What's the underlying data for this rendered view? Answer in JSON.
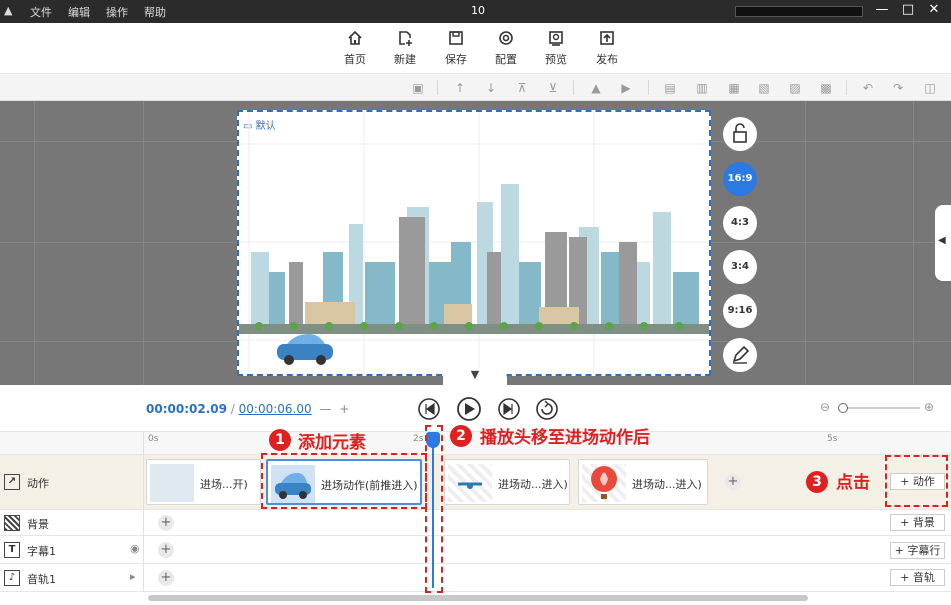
{
  "titlebar": {
    "menus": [
      "文件",
      "编辑",
      "操作",
      "帮助"
    ],
    "title": "10",
    "min": "—",
    "max": "□",
    "close": "✕"
  },
  "toolbar": {
    "items": [
      {
        "label": "首页",
        "icon": "home-icon"
      },
      {
        "label": "新建",
        "icon": "new-file-icon"
      },
      {
        "label": "保存",
        "icon": "save-icon"
      },
      {
        "label": "配置",
        "icon": "settings-icon"
      },
      {
        "label": "预览",
        "icon": "preview-icon"
      },
      {
        "label": "发布",
        "icon": "publish-icon"
      }
    ]
  },
  "canvas": {
    "scene_label": "默认"
  },
  "ratios": [
    "16:9",
    "4:3",
    "3:4",
    "9:16"
  ],
  "timeline": {
    "current_time": "00:00:02.09",
    "separator": "/",
    "total_time": "00:00:06.00",
    "zoom_minus": "—",
    "zoom_plus": "+",
    "ruler": {
      "start": "0s",
      "mid": "2s",
      "end": "5s"
    },
    "rows": [
      {
        "label": "动作",
        "add_label": "+ 动作"
      },
      {
        "label": "背景",
        "add_label": "+ 背景"
      },
      {
        "label": "字幕1",
        "add_label": "+ 字幕行"
      },
      {
        "label": "音轨1",
        "add_label": "+ 音轨"
      }
    ],
    "clips": [
      {
        "text": "进场...开)"
      },
      {
        "text": "进场动作(前推进入)"
      },
      {
        "text": "进场动...进入)"
      },
      {
        "text": "进场动...进入)"
      }
    ]
  },
  "annotations": {
    "step1_num": "1",
    "step1_text": "添加元素",
    "step2_num": "2",
    "step2_text": "播放头移至进场动作后",
    "step3_num": "3",
    "step3_text": "点击"
  },
  "colors": {
    "accent": "#2a7ae2",
    "annotation_red": "#e02020"
  }
}
